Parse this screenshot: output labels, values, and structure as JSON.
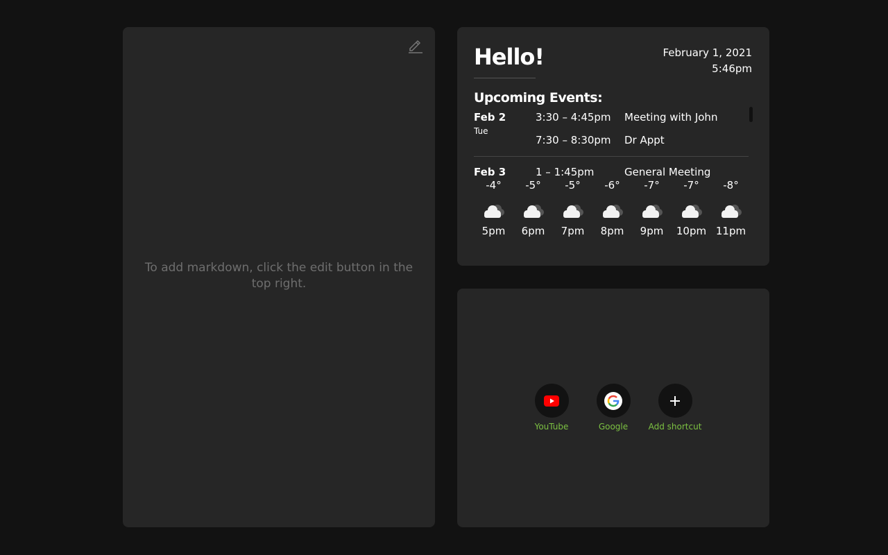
{
  "notes": {
    "placeholder": "To add markdown, click the edit button in the top right.",
    "edit_icon": "pencil-icon"
  },
  "greeting": {
    "title": "Hello!",
    "date": "February 1, 2021",
    "time": "5:46pm"
  },
  "events": {
    "title": "Upcoming Events:",
    "days": [
      {
        "date": "Feb 2",
        "weekday": "Tue",
        "items": [
          {
            "time": "3:30 – 4:45pm",
            "name": "Meeting with John"
          },
          {
            "time": "7:30 – 8:30pm",
            "name": "Dr Appt"
          }
        ]
      },
      {
        "date": "Feb 3",
        "weekday": "",
        "items": [
          {
            "time": "1 – 1:45pm",
            "name": "General Meeting"
          }
        ]
      }
    ]
  },
  "weather": {
    "icon": "cloudy-icon",
    "hours": [
      {
        "temp": "-4°",
        "hour": "5pm"
      },
      {
        "temp": "-5°",
        "hour": "6pm"
      },
      {
        "temp": "-5°",
        "hour": "7pm"
      },
      {
        "temp": "-6°",
        "hour": "8pm"
      },
      {
        "temp": "-7°",
        "hour": "9pm"
      },
      {
        "temp": "-7°",
        "hour": "10pm"
      },
      {
        "temp": "-8°",
        "hour": "11pm"
      }
    ]
  },
  "shortcuts": [
    {
      "label": "YouTube",
      "icon": "youtube-icon"
    },
    {
      "label": "Google",
      "icon": "google-icon"
    },
    {
      "label": "Add shortcut",
      "icon": "plus-icon"
    }
  ],
  "colors": {
    "background": "#121212",
    "panel": "#262626",
    "shortcut_label": "#7cc142"
  }
}
